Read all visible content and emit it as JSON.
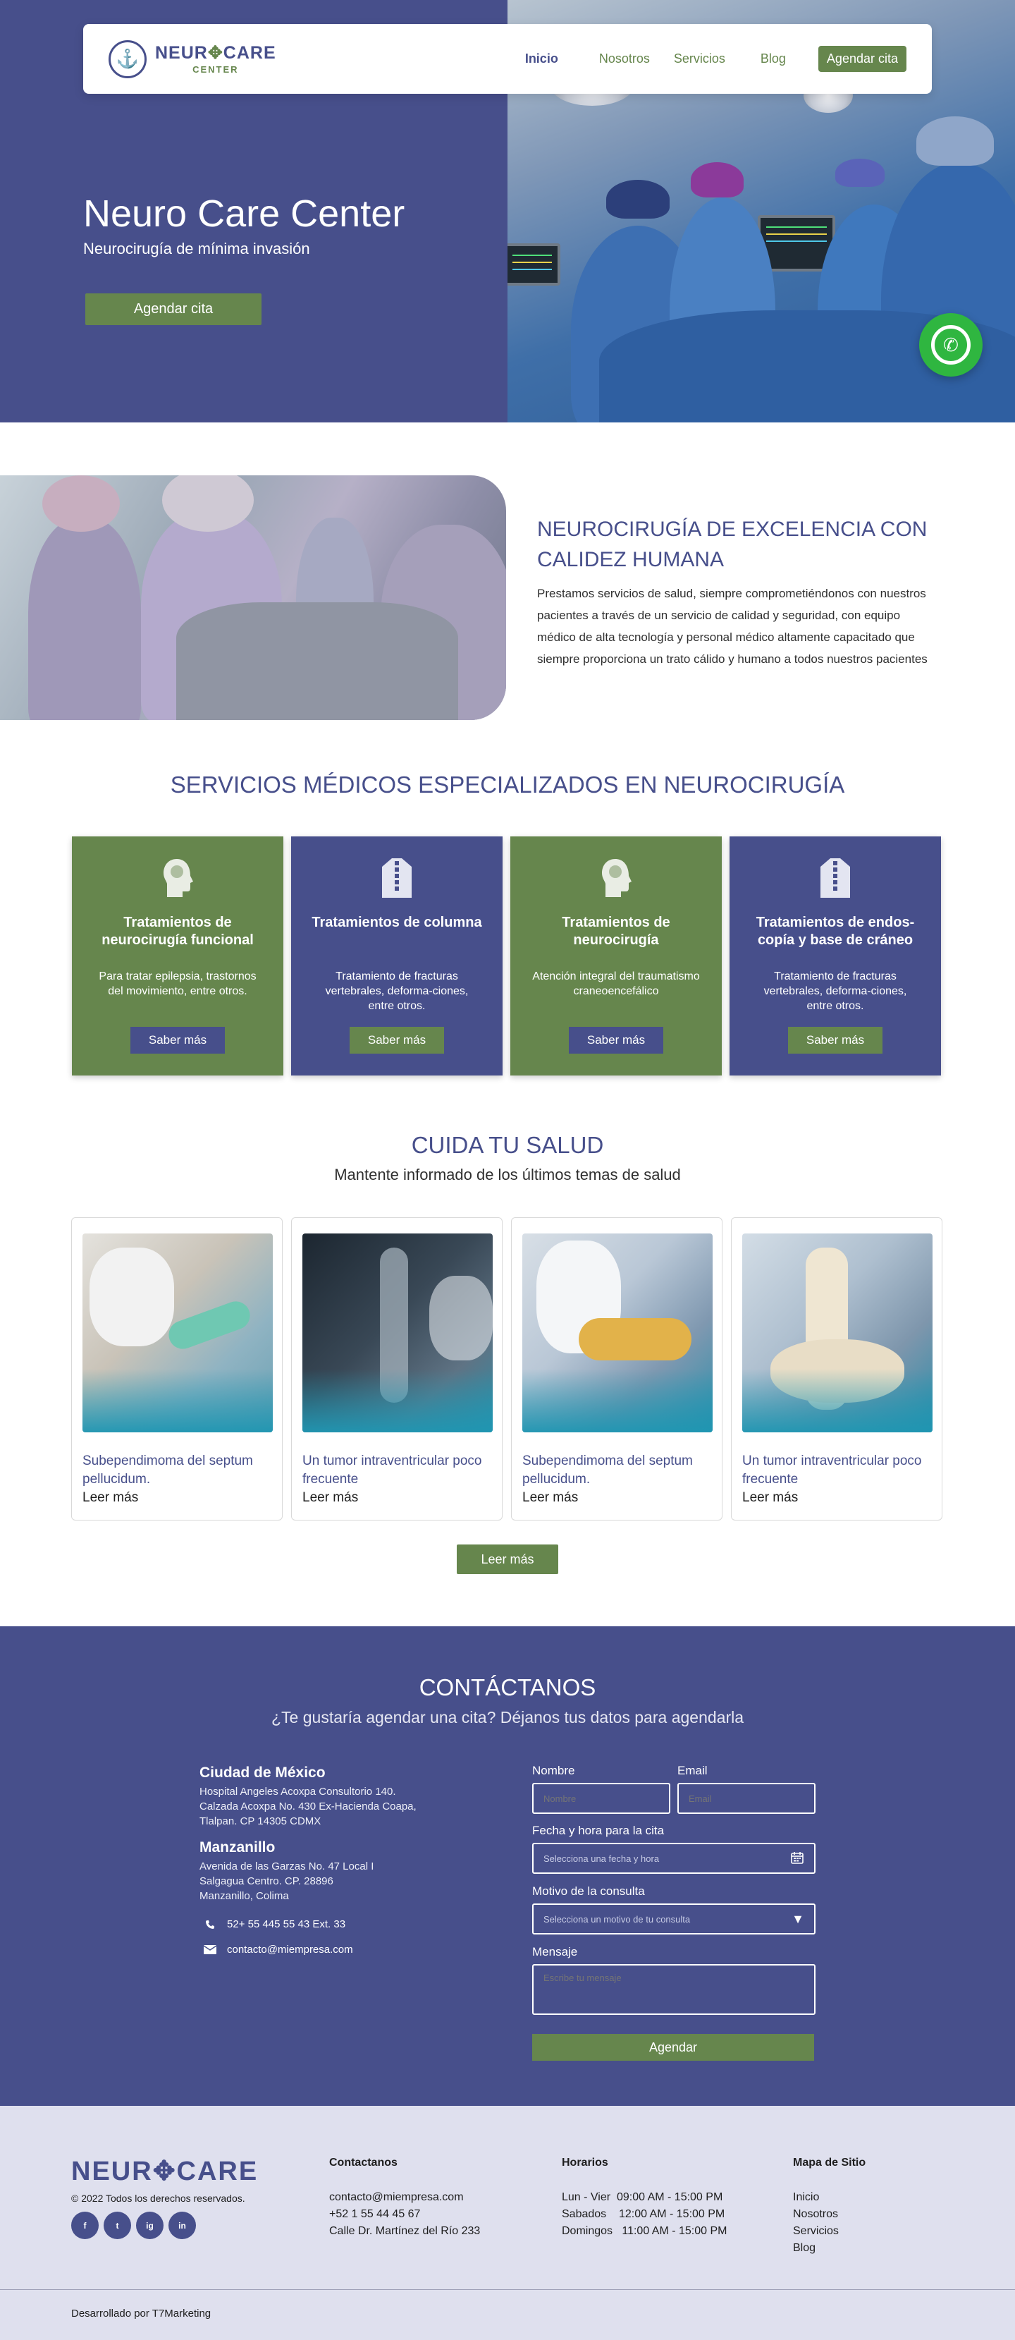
{
  "brand": {
    "logo_main_left": "NEUR",
    "logo_main_right": "CARE",
    "logo_sub": "CENTER"
  },
  "nav": {
    "items": [
      "Inicio",
      "Nosotros",
      "Servicios",
      "Blog"
    ],
    "cta": "Agendar cita"
  },
  "hero": {
    "title": "Neuro Care Center",
    "subtitle": "Neurocirugía de mínima invasión",
    "button": "Agendar cita"
  },
  "intro": {
    "title": "NEUROCIRUGÍA DE EXCELENCIA CON CALIDEZ HUMANA",
    "text": "Prestamos servicios de salud, siempre comprometiéndonos con nuestros pacientes a través de un servicio de calidad y seguridad, con equipo médico de alta tecnología y personal médico altamente capacitado que siempre proporciona un trato cálido y humano a todos nuestros pacientes"
  },
  "services": {
    "title": "SERVICIOS MÉDICOS ESPECIALIZADOS EN NEUROCIRUGÍA",
    "cards": [
      {
        "title": "Tratamientos de neurocirugía funcional",
        "text": "Para tratar epilepsia, trastornos del movimiento, entre otros.",
        "button": "Saber más",
        "icon": "head-icon",
        "color": "#66864d"
      },
      {
        "title": "Tratamientos de columna",
        "text": "Tratamiento de fracturas vertebrales, deforma-ciones, entre otros.",
        "button": "Saber más",
        "icon": "spine-body-icon",
        "color": "#474f8b"
      },
      {
        "title": "Tratamientos de neurocirugía",
        "text": "Atención integral del traumatismo craneoencefálico",
        "button": "Saber más",
        "icon": "head-icon",
        "color": "#66864d"
      },
      {
        "title": "Tratamientos de endos-copía y base de cráneo",
        "text": "Tratamiento de fracturas vertebrales, deforma-ciones, entre otros.",
        "button": "Saber más",
        "icon": "spine-body-icon",
        "color": "#474f8b"
      }
    ]
  },
  "blog": {
    "title": "CUIDA TU SALUD",
    "subtitle": "Mantente informado de los últimos temas de salud",
    "posts": [
      {
        "title": "Subependimoma del septum pellucidum.",
        "link": "Leer más"
      },
      {
        "title": "Un tumor intraventricular poco frecuente",
        "link": "Leer más"
      },
      {
        "title": "Subependimoma del septum pellucidum.",
        "link": "Leer más"
      },
      {
        "title": "Un tumor intraventricular poco frecuente",
        "link": "Leer más"
      }
    ],
    "more_button": "Leer más"
  },
  "contact": {
    "title": "CONTÁCTANOS",
    "subtitle": "¿Te gustaría agendar una cita?  Déjanos tus datos para agendarla",
    "locations": [
      {
        "city": "Ciudad de México",
        "lines": [
          "Hospital Angeles Acoxpa Consultorio 140.",
          "Calzada Acoxpa No. 430 Ex-Hacienda Coapa,",
          "Tlalpan. CP 14305 CDMX"
        ]
      },
      {
        "city": "Manzanillo",
        "lines": [
          "Avenida de las Garzas No. 47 Local I",
          "Salgagua Centro. CP. 28896",
          "Manzanillo, Colima"
        ]
      }
    ],
    "phone": "52+ 55 445 55 43 Ext. 33",
    "email": "contacto@miempresa.com",
    "form": {
      "name_label": "Nombre",
      "name_placeholder": "Nombre",
      "email_label": "Email",
      "email_placeholder": "Email",
      "date_label": "Fecha y hora para la cita",
      "date_placeholder": "Selecciona una fecha y hora",
      "reason_label": "Motivo de la consulta",
      "reason_placeholder": "Selecciona un motivo de tu consulta",
      "message_label": "Mensaje",
      "message_placeholder": "Escribe tu mensaje",
      "submit": "Agendar"
    }
  },
  "footer": {
    "copyright": "© 2022 Todos los derechos reservados.",
    "socials": [
      "f",
      "t",
      "ig",
      "in"
    ],
    "contact_head": "Contactanos",
    "contact_lines": [
      "contacto@miempresa.com",
      "+52 1 55 44 45 67",
      "Calle Dr. Martínez del Río 233"
    ],
    "hours_head": "Horarios",
    "hours_lines": [
      "Lun - Vier  09:00 AM - 15:00 PM",
      "Sabados    12:00 AM - 15:00 PM",
      "Domingos   11:00 AM - 15:00 PM"
    ],
    "sitemap_head": "Mapa de Sitio",
    "sitemap_links": [
      "Inicio",
      "Nosotros",
      "Servicios",
      "Blog"
    ],
    "credit": "Desarrollado por T7Marketing"
  },
  "colors": {
    "primary_blue": "#474f8b",
    "primary_green": "#66864d",
    "footer_bg": "#dfe0ee",
    "whatsapp": "#2fb640"
  }
}
